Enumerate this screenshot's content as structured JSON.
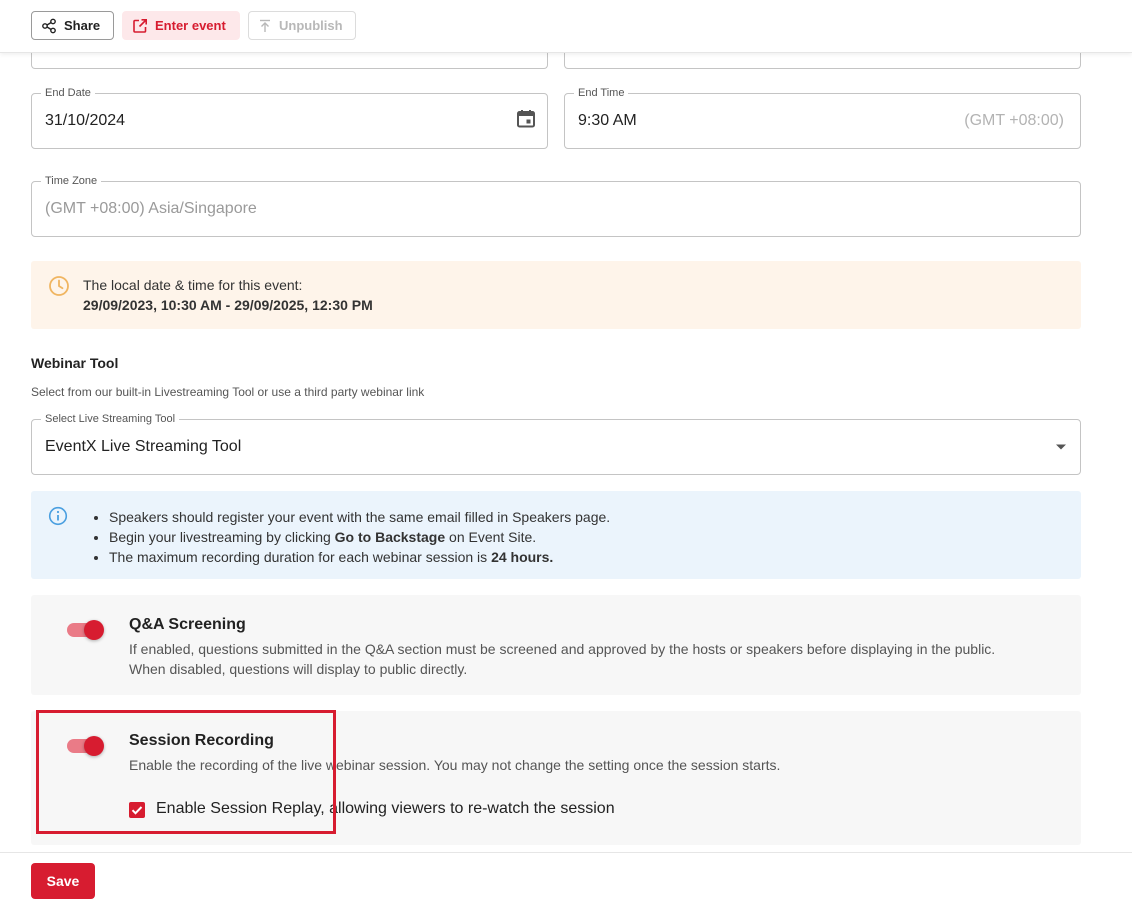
{
  "toolbar": {
    "share_label": "Share",
    "enter_event_label": "Enter event",
    "unpublish_label": "Unpublish"
  },
  "form": {
    "end_date": {
      "label": "End Date",
      "value": "31/10/2024"
    },
    "end_time": {
      "label": "End Time",
      "value": "9:30 AM",
      "suffix": "(GMT +08:00)"
    },
    "time_zone": {
      "label": "Time Zone",
      "value": "(GMT +08:00) Asia/Singapore"
    }
  },
  "local_time_banner": {
    "line1": "The local date & time for this event:",
    "line2": "29/09/2023, 10:30 AM - 29/09/2025, 12:30 PM"
  },
  "webinar": {
    "title": "Webinar Tool",
    "subtitle": "Select from our built-in Livestreaming Tool or use a third party webinar link",
    "select_label": "Select Live Streaming Tool",
    "select_value": "EventX Live Streaming Tool"
  },
  "tips": {
    "item1": "Speakers should register your event with the same email filled in Speakers page.",
    "item2_pre": "Begin your livestreaming by clicking ",
    "item2_bold": "Go to Backstage",
    "item2_post": " on Event Site.",
    "item3_pre": "The maximum recording duration for each webinar session is ",
    "item3_bold": "24 hours."
  },
  "qa_screening": {
    "title": "Q&A Screening",
    "description": "If enabled, questions submitted in the Q&A section must be screened and approved by the hosts or speakers before displaying in the public. When disabled, questions will display to public directly.",
    "enabled": true
  },
  "session_recording": {
    "title": "Session Recording",
    "description": "Enable the recording of the live webinar session. You may not change the setting once the session starts.",
    "enabled": true,
    "replay_label": "Enable Session Replay, allowing viewers to re-watch the session",
    "replay_checked": true
  },
  "footer": {
    "save_label": "Save"
  },
  "colors": {
    "accent": "#d71c30",
    "accent_light": "#fde8ea",
    "warning_bg": "#fef4ea",
    "info_bg": "#ebf4fc"
  },
  "icons": [
    "share-icon",
    "external-link-icon",
    "upload-icon",
    "calendar-icon",
    "clock-icon",
    "info-icon",
    "dropdown-arrow-icon",
    "checkmark-icon"
  ]
}
